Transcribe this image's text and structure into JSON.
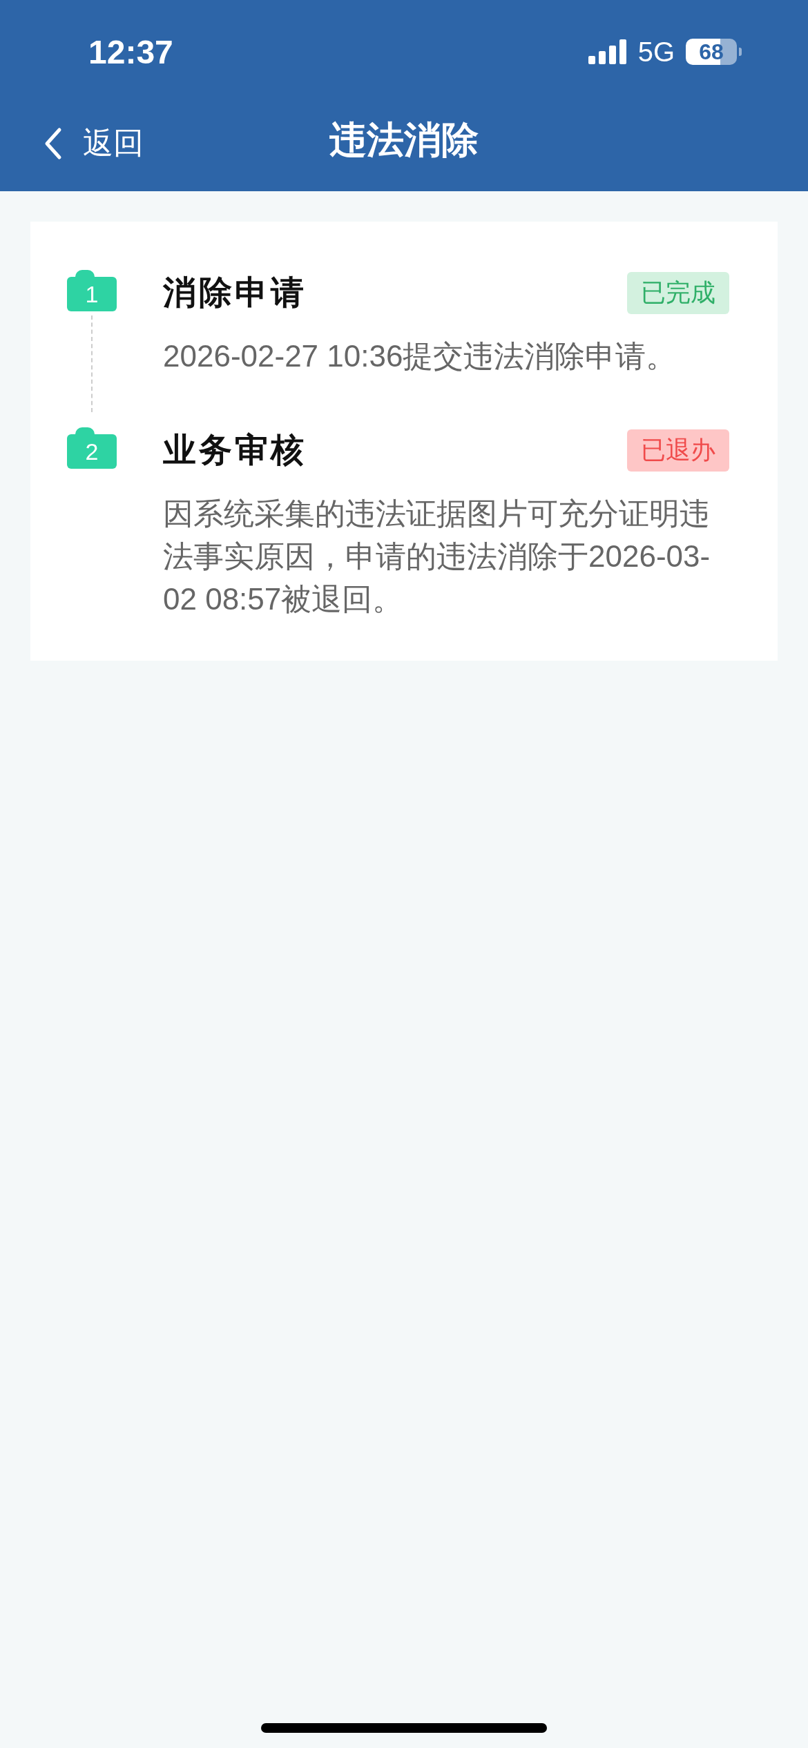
{
  "status_bar": {
    "time": "12:37",
    "network": "5G",
    "battery": "68"
  },
  "nav": {
    "back": "返回",
    "title": "违法消除"
  },
  "steps": [
    {
      "number": "1",
      "title": "消除申请",
      "kind": "completed",
      "badge": "已完成",
      "description": "2026-02-27 10:36提交违法消除申请。"
    },
    {
      "number": "2",
      "title": "业务审核",
      "kind": "returned",
      "badge": "已退办",
      "description": "因系统采集的违法证据图片可充分证明违法事实原因，申请的违法消除于2026-03-02 08:57被退回。"
    }
  ]
}
